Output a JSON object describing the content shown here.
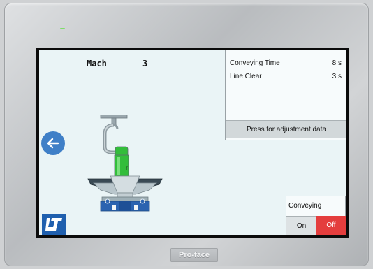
{
  "header": {
    "mach_label": "Mach",
    "mach_value": "3"
  },
  "info_panel": {
    "rows": [
      {
        "label": "Conveying Time",
        "value": "8 s"
      },
      {
        "label": "Line Clear",
        "value": "3 s"
      }
    ],
    "adjust_button_label": "Press for adjustment data"
  },
  "conveying": {
    "label": "Conveying",
    "on_label": "On",
    "off_label": "Off",
    "state": "Off"
  },
  "icons": {
    "back": "left-arrow-icon",
    "logo": "company-logo-icon"
  },
  "device": {
    "brand": "Pro-face"
  },
  "colors": {
    "screen_background": "#eaf4f6",
    "back_button": "#3f7fc7",
    "off_button_active": "#e43d3d",
    "material_green": "#35c33b",
    "logo_blue": "#1f5fae"
  }
}
